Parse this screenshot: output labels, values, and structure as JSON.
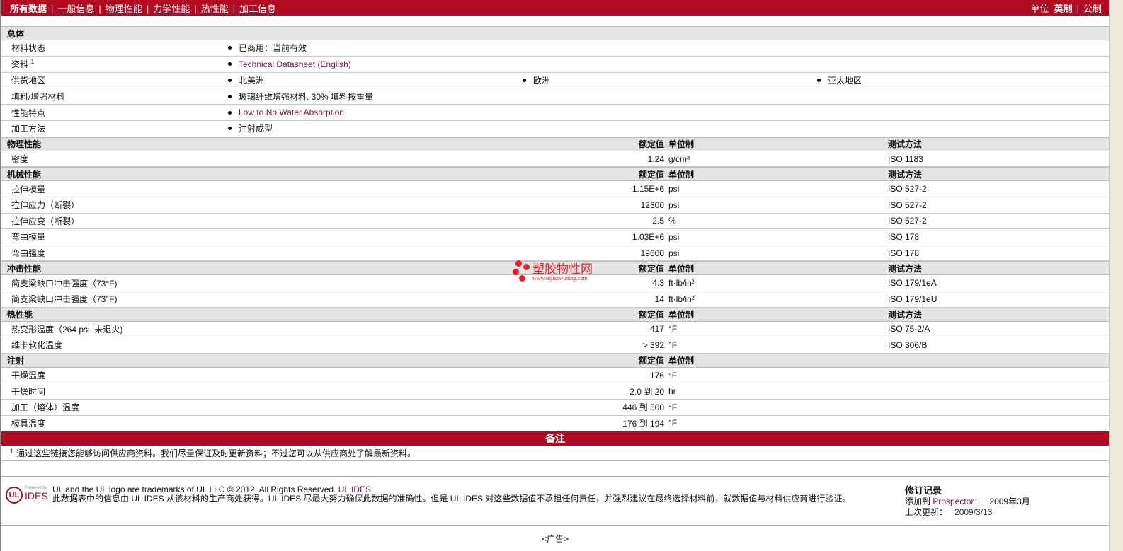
{
  "nav": {
    "items": [
      "所有数据",
      "一般信息",
      "物理性能",
      "力学性能",
      "热性能",
      "加工信息"
    ],
    "units_label": "单位",
    "unit_english": "英制",
    "unit_metric": "公制"
  },
  "general": {
    "title": "总体",
    "rows": [
      {
        "label": "材料状态",
        "values": [
          "已商用：当前有效"
        ]
      },
      {
        "label": "资料",
        "sup": "1",
        "values": [
          "Technical Datasheet (English)"
        ],
        "link": true
      },
      {
        "label": "供货地区",
        "values": [
          "北美洲",
          "欧洲",
          "亚太地区"
        ]
      },
      {
        "label": "填料/增强材料",
        "values": [
          "玻璃纤维增强材料, 30% 填料按重量"
        ]
      },
      {
        "label": "性能特点",
        "values": [
          "Low to No Water Absorption"
        ],
        "link": true
      },
      {
        "label": "加工方法",
        "values": [
          "注射成型"
        ]
      }
    ]
  },
  "col_headers": {
    "value": "额定值",
    "unit": "单位制",
    "method": "测试方法"
  },
  "sections": [
    {
      "title": "物理性能",
      "method": true,
      "rows": [
        {
          "label": "密度",
          "value": "1.24",
          "unit": "g/cm³",
          "method": "ISO 1183"
        }
      ]
    },
    {
      "title": "机械性能",
      "method": true,
      "rows": [
        {
          "label": "拉伸模量",
          "value": "1.15E+6",
          "unit": "psi",
          "method": "ISO 527-2"
        },
        {
          "label": "拉伸应力（断裂）",
          "value": "12300",
          "unit": "psi",
          "method": "ISO 527-2"
        },
        {
          "label": "拉伸应变（断裂）",
          "value": "2.5",
          "unit": "%",
          "method": "ISO 527-2"
        },
        {
          "label": "弯曲模量",
          "value": "1.03E+6",
          "unit": "psi",
          "method": "ISO 178"
        },
        {
          "label": "弯曲强度",
          "value": "19600",
          "unit": "psi",
          "method": "ISO 178"
        }
      ]
    },
    {
      "title": "冲击性能",
      "method": true,
      "rows": [
        {
          "label": "简支梁缺口冲击强度（73°F)",
          "value": "4.3",
          "unit": "ft·lb/in²",
          "method": "ISO 179/1eA"
        },
        {
          "label": "简支梁缺口冲击强度（73°F)",
          "value": "14",
          "unit": "ft·lb/in²",
          "method": "ISO 179/1eU"
        }
      ]
    },
    {
      "title": "热性能",
      "method": true,
      "rows": [
        {
          "label": "热变形温度（264 psi, 未退火)",
          "value": "417",
          "unit": "°F",
          "method": "ISO 75-2/A"
        },
        {
          "label": "维卡软化温度",
          "value": "> 392",
          "unit": "°F",
          "method": "ISO 306/B"
        }
      ]
    },
    {
      "title": "注射",
      "method": false,
      "rows": [
        {
          "label": "干燥温度",
          "value": "176",
          "unit": "°F",
          "method": ""
        },
        {
          "label": "干燥时间",
          "value": "2.0 到  20",
          "unit": "hr",
          "method": ""
        },
        {
          "label": "加工（熔体）温度",
          "value": "446 到  500",
          "unit": "°F",
          "method": ""
        },
        {
          "label": "模具温度",
          "value": "176 到  194",
          "unit": "°F",
          "method": ""
        }
      ]
    }
  ],
  "notes": {
    "title": "备注",
    "sup": "1",
    "text": "通过这些链接您能够访问供应商资料。我们尽量保证及时更新资料；不过您可以从供应商处了解最新资料。"
  },
  "footer": {
    "logo_text": "IDES",
    "logo_powered": "Powered by",
    "logo_ul": "UL",
    "line1": "UL and the UL logo are trademarks of UL LLC © 2012. All Rights Reserved.",
    "line1_link": "UL IDES",
    "line2": "此数据表中的信息由  UL IDES 从该材料的生产商处获得。UL IDES 尽最大努力确保此数据的准确性。但是  UL IDES 对这些数据值不承担任何责任，并强烈建议在最终选择材料前，就数据值与材料供应商进行验证。",
    "revision_title": "修订记录",
    "added_label": "添加到",
    "added_link": "Prospector：",
    "added_date": "2009年3月",
    "updated_label": "上次更新：",
    "updated_date": "2009/3/13"
  },
  "ad": "<广告>",
  "watermark": {
    "name": "塑胶物性网",
    "url": "www.sujiaowuxing.com"
  },
  "colors": {
    "brand": "#b20a20",
    "link": "#7a1650",
    "section": "#e4e4e4"
  }
}
